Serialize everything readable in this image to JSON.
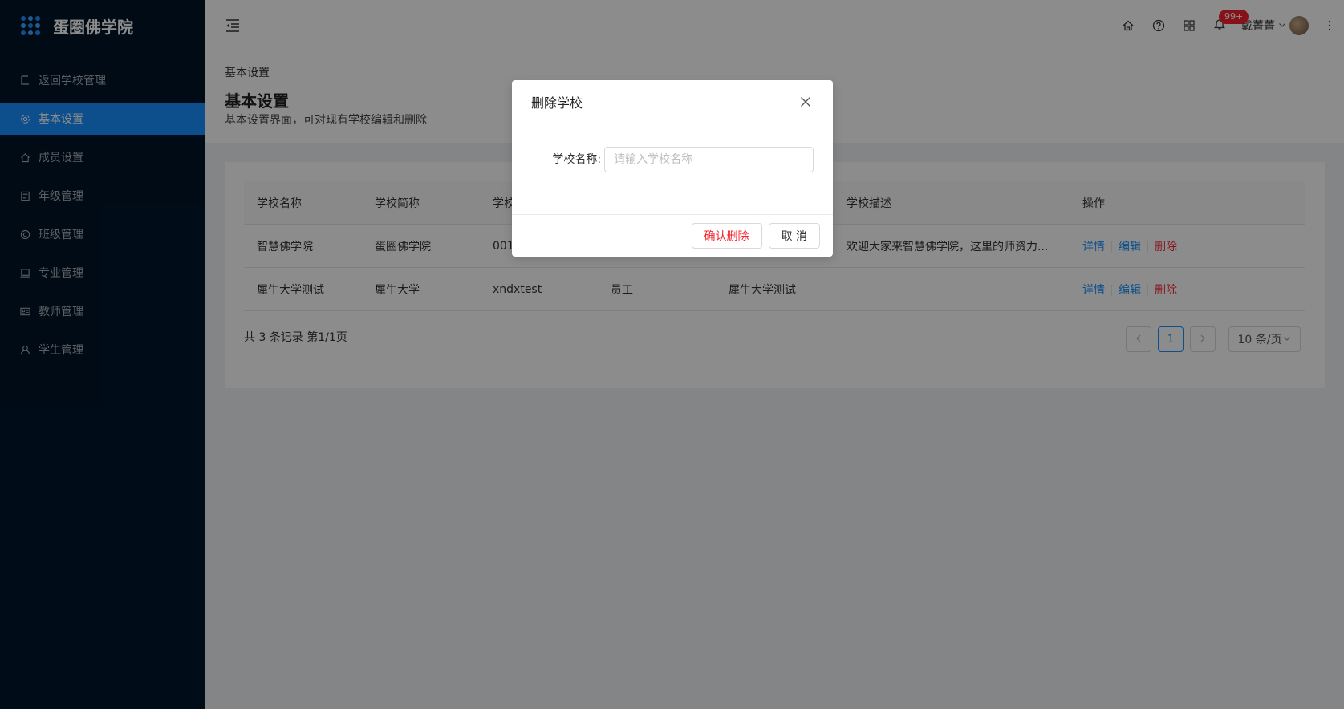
{
  "app": {
    "title": "蛋圈佛学院"
  },
  "sidebar": {
    "items": [
      {
        "label": "返回学校管理",
        "icon": "return-icon"
      },
      {
        "label": "基本设置",
        "icon": "gear-icon",
        "active": true
      },
      {
        "label": "成员设置",
        "icon": "home-icon"
      },
      {
        "label": "年级管理",
        "icon": "book-icon"
      },
      {
        "label": "班级管理",
        "icon": "copyright-icon"
      },
      {
        "label": "专业管理",
        "icon": "laptop-icon"
      },
      {
        "label": "教师管理",
        "icon": "idcard-icon"
      },
      {
        "label": "学生管理",
        "icon": "user-icon"
      }
    ]
  },
  "header": {
    "badge": "99+",
    "user_name": "戴菁菁"
  },
  "page": {
    "breadcrumb": "基本设置",
    "title": "基本设置",
    "description": "基本设置界面，可对现有学校编辑和删除"
  },
  "table": {
    "columns": [
      "学校名称",
      "学校简称",
      "学校",
      "",
      "",
      "学校描述",
      "操作"
    ],
    "rows": [
      {
        "name": "智慧佛学院",
        "short": "蛋圈佛学院",
        "code": "001",
        "type": "",
        "org": "",
        "desc": "欢迎大家来智慧佛学院，这里的师资力..."
      },
      {
        "name": "犀牛大学测试",
        "short": "犀牛大学",
        "code": "xndxtest",
        "type": "员工",
        "org": "犀牛大学测试",
        "desc": ""
      }
    ],
    "actions": {
      "detail": "详情",
      "edit": "编辑",
      "delete": "删除"
    }
  },
  "pagination": {
    "total_text": "共 3 条记录 第1/1页",
    "current": "1",
    "page_size": "10 条/页"
  },
  "modal": {
    "title": "删除学校",
    "label": "学校名称:",
    "placeholder": "请输入学校名称",
    "confirm": "确认删除",
    "cancel": "取 消"
  }
}
